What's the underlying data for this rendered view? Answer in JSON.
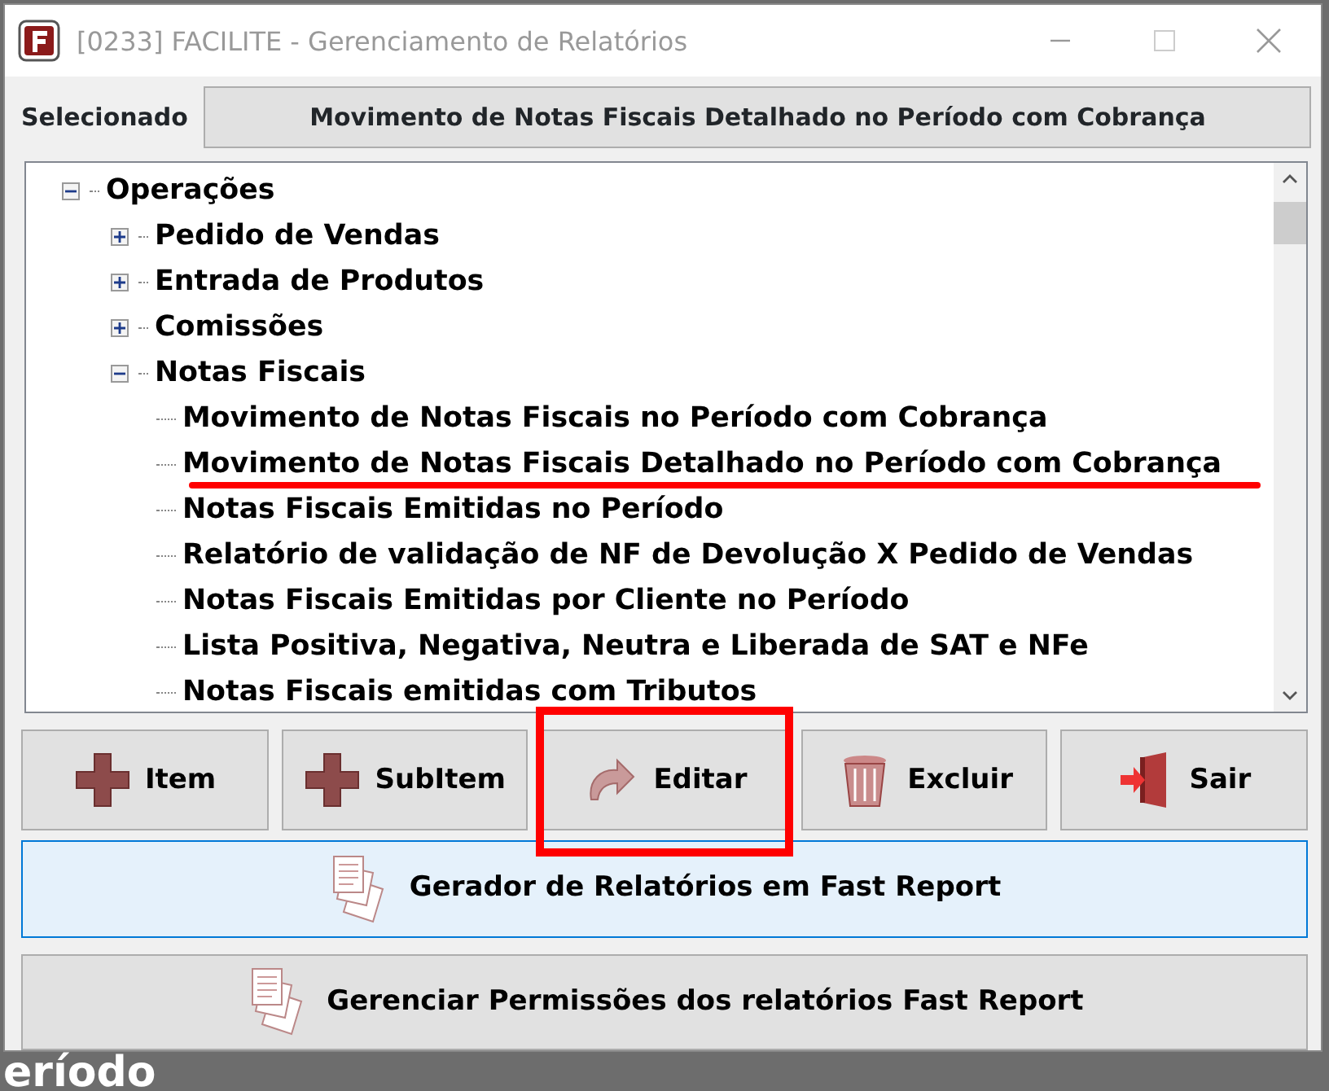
{
  "window": {
    "title": "[0233] FACILITE - Gerenciamento de Relatórios"
  },
  "selected": {
    "label": "Selecionado",
    "value": "Movimento de Notas Fiscais Detalhado no Período com Cobrança"
  },
  "tree": [
    {
      "label": "Operações",
      "expanded": true,
      "underlined": false,
      "children": [
        {
          "label": "Pedido de Vendas",
          "expanded": false,
          "underlined": false
        },
        {
          "label": "Entrada de Produtos",
          "expanded": false,
          "underlined": false
        },
        {
          "label": "Comissões",
          "expanded": false,
          "underlined": false
        },
        {
          "label": "Notas Fiscais",
          "expanded": true,
          "underlined": false,
          "children": [
            {
              "label": "Movimento de Notas Fiscais no Período com Cobrança",
              "underlined": false
            },
            {
              "label": "Movimento de Notas Fiscais Detalhado no Período com Cobrança",
              "underlined": true
            },
            {
              "label": "Notas Fiscais Emitidas no Período",
              "underlined": false
            },
            {
              "label": "Relatório de validação de NF de Devolução X Pedido de Vendas",
              "underlined": false
            },
            {
              "label": "Notas Fiscais Emitidas por Cliente no Período",
              "underlined": false
            },
            {
              "label": "Lista Positiva, Negativa, Neutra e Liberada de SAT e NFe",
              "underlined": false
            },
            {
              "label": "Notas Fiscais emitidas com Tributos",
              "underlined": false
            }
          ]
        }
      ]
    }
  ],
  "buttons": [
    {
      "label": "Item",
      "kind": "plus",
      "highlighted": false
    },
    {
      "label": "SubItem",
      "kind": "plus",
      "highlighted": false
    },
    {
      "label": "Editar",
      "kind": "redo",
      "highlighted": true
    },
    {
      "label": "Excluir",
      "kind": "trash",
      "highlighted": false
    },
    {
      "label": "Sair",
      "kind": "exit",
      "highlighted": false
    }
  ],
  "wide_buttons": [
    {
      "label": "Gerador de Relatórios em Fast Report",
      "focused": true
    },
    {
      "label": "Gerenciar Permissões dos relatórios Fast Report",
      "focused": false
    }
  ],
  "background_text": "eríodo"
}
